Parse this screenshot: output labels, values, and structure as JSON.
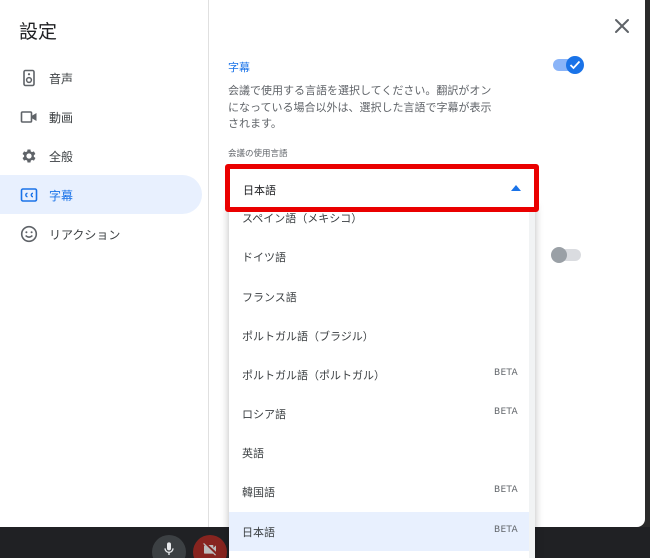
{
  "dialog": {
    "title": "設定",
    "close_icon": "close-icon"
  },
  "sidebar": {
    "items": [
      {
        "label": "音声",
        "icon": "speaker-icon",
        "active": false
      },
      {
        "label": "動画",
        "icon": "video-camera-icon",
        "active": false
      },
      {
        "label": "全般",
        "icon": "gear-icon",
        "active": false
      },
      {
        "label": "字幕",
        "icon": "captions-icon",
        "active": true
      },
      {
        "label": "リアクション",
        "icon": "smiley-icon",
        "active": false
      }
    ]
  },
  "captions": {
    "title": "字幕",
    "description": "会議で使用する言語を選択してください。翻訳がオンになっている場合以外は、選択した言語で字幕が表示されます。",
    "language_label": "会議の使用言語",
    "selected_language": "日本語",
    "toggle_on": true
  },
  "language_options": [
    {
      "label": "スペイン語（メキシコ）",
      "beta": ""
    },
    {
      "label": "ドイツ語",
      "beta": ""
    },
    {
      "label": "フランス語",
      "beta": ""
    },
    {
      "label": "ポルトガル語（ブラジル）",
      "beta": ""
    },
    {
      "label": "ポルトガル語（ポルトガル）",
      "beta": "BETA"
    },
    {
      "label": "ロシア語",
      "beta": "BETA"
    },
    {
      "label": "英語",
      "beta": ""
    },
    {
      "label": "韓国語",
      "beta": "BETA"
    },
    {
      "label": "日本語",
      "beta": "BETA"
    }
  ],
  "colors": {
    "accent": "#1a73e8",
    "highlight_border": "#ea0000",
    "selected_bg": "#e8f0fe"
  }
}
